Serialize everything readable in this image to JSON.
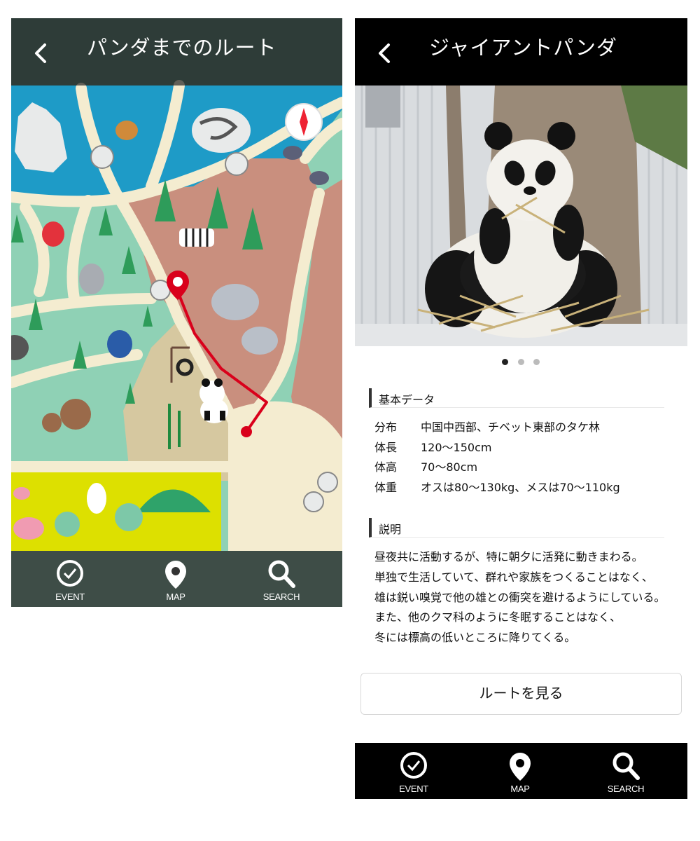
{
  "map_screen": {
    "title": "パンダまでのルート",
    "back_icon": "chevron-left-icon",
    "tabs": [
      {
        "label": "EVENT",
        "icon": "check-circle-icon"
      },
      {
        "label": "MAP",
        "icon": "map-pin-icon"
      },
      {
        "label": "SEARCH",
        "icon": "search-icon"
      }
    ],
    "colors": {
      "route": "#d9001b",
      "water": "#1e9bc7",
      "path": "#f4ecd0",
      "land_brown": "#c98f7e",
      "land_green": "#8fd1b5",
      "land_yellow": "#dde000"
    }
  },
  "detail_screen": {
    "title": "ジャイアントパンダ",
    "back_icon": "chevron-left-icon",
    "photo_alt_icon": "panda-photo",
    "carousel": {
      "count": 3,
      "active": 0
    },
    "basic_data": {
      "heading": "基本データ",
      "rows": [
        {
          "key": "分布",
          "value": "中国中西部、チベット東部のタケ林"
        },
        {
          "key": "体長",
          "value": "120〜150cm"
        },
        {
          "key": "体高",
          "value": "70〜80cm"
        },
        {
          "key": "体重",
          "value": "オスは80〜130kg、メスは70〜110kg"
        }
      ]
    },
    "description": {
      "heading": "説明",
      "lines": [
        "昼夜共に活動するが、特に朝夕に活発に動きまわる。",
        "単独で生活していて、群れや家族をつくることはなく、",
        "雄は鋭い嗅覚で他の雄との衝突を避けるようにしている。",
        "また、他のクマ科のように冬眠することはなく、",
        "冬には標高の低いところに降りてくる。"
      ]
    },
    "route_button": "ルートを見る",
    "tabs": [
      {
        "label": "EVENT",
        "icon": "check-circle-icon"
      },
      {
        "label": "MAP",
        "icon": "map-pin-icon"
      },
      {
        "label": "SEARCH",
        "icon": "search-icon"
      }
    ]
  }
}
